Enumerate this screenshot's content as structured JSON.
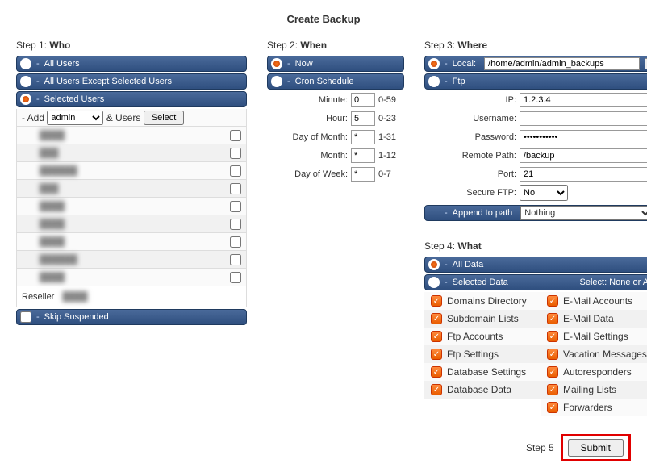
{
  "title": "Create Backup",
  "step1": {
    "label_prefix": "Step 1: ",
    "label_bold": "Who",
    "opt_all": "All Users",
    "opt_except": "All Users Except Selected Users",
    "opt_selected": "Selected Users",
    "add_prefix": "- Add",
    "add_select_value": "admin",
    "add_users_text": "& Users",
    "select_btn": "Select",
    "users": [
      "████",
      "███",
      "██████",
      "███",
      "████",
      "████",
      "████",
      "██████",
      "████"
    ],
    "reseller_label": "Reseller",
    "reseller_value": "████",
    "skip_label": "Skip Suspended"
  },
  "step2": {
    "label_prefix": "Step 2: ",
    "label_bold": "When",
    "opt_now": "Now",
    "opt_cron": "Cron Schedule",
    "rows": [
      {
        "label": "Minute:",
        "value": "0",
        "range": "0-59"
      },
      {
        "label": "Hour:",
        "value": "5",
        "range": "0-23"
      },
      {
        "label": "Day of Month:",
        "value": "*",
        "range": "1-31"
      },
      {
        "label": "Month:",
        "value": "*",
        "range": "1-12"
      },
      {
        "label": "Day of Week:",
        "value": "*",
        "range": "0-7"
      }
    ]
  },
  "step3": {
    "label_prefix": "Step 3: ",
    "label_bold": "Where",
    "local_label": "Local:",
    "local_path": "/home/admin/admin_backups",
    "ftp_label": "Ftp",
    "rows": [
      {
        "label": "IP:",
        "value": "1.2.3.4",
        "type": "text"
      },
      {
        "label": "Username:",
        "value": "",
        "type": "text"
      },
      {
        "label": "Password:",
        "value": "•••••••••••",
        "type": "password"
      },
      {
        "label": "Remote Path:",
        "value": "/backup",
        "type": "text"
      },
      {
        "label": "Port:",
        "value": "21",
        "type": "text"
      }
    ],
    "secure_label": "Secure FTP:",
    "secure_value": "No",
    "append_label": "Append to path",
    "append_value": "Nothing"
  },
  "step4": {
    "label_prefix": "Step 4: ",
    "label_bold": "What",
    "opt_all": "All Data",
    "opt_sel": "Selected Data",
    "select_hint": "Select: None or All",
    "left": [
      "Domains Directory",
      "Subdomain Lists",
      "Ftp Accounts",
      "Ftp Settings",
      "Database Settings",
      "Database Data"
    ],
    "right": [
      "E-Mail Accounts",
      "E-Mail Data",
      "E-Mail Settings",
      "Vacation Messages",
      "Autoresponders",
      "Mailing Lists",
      "Forwarders"
    ]
  },
  "step5": {
    "label": "Step 5",
    "submit": "Submit"
  }
}
